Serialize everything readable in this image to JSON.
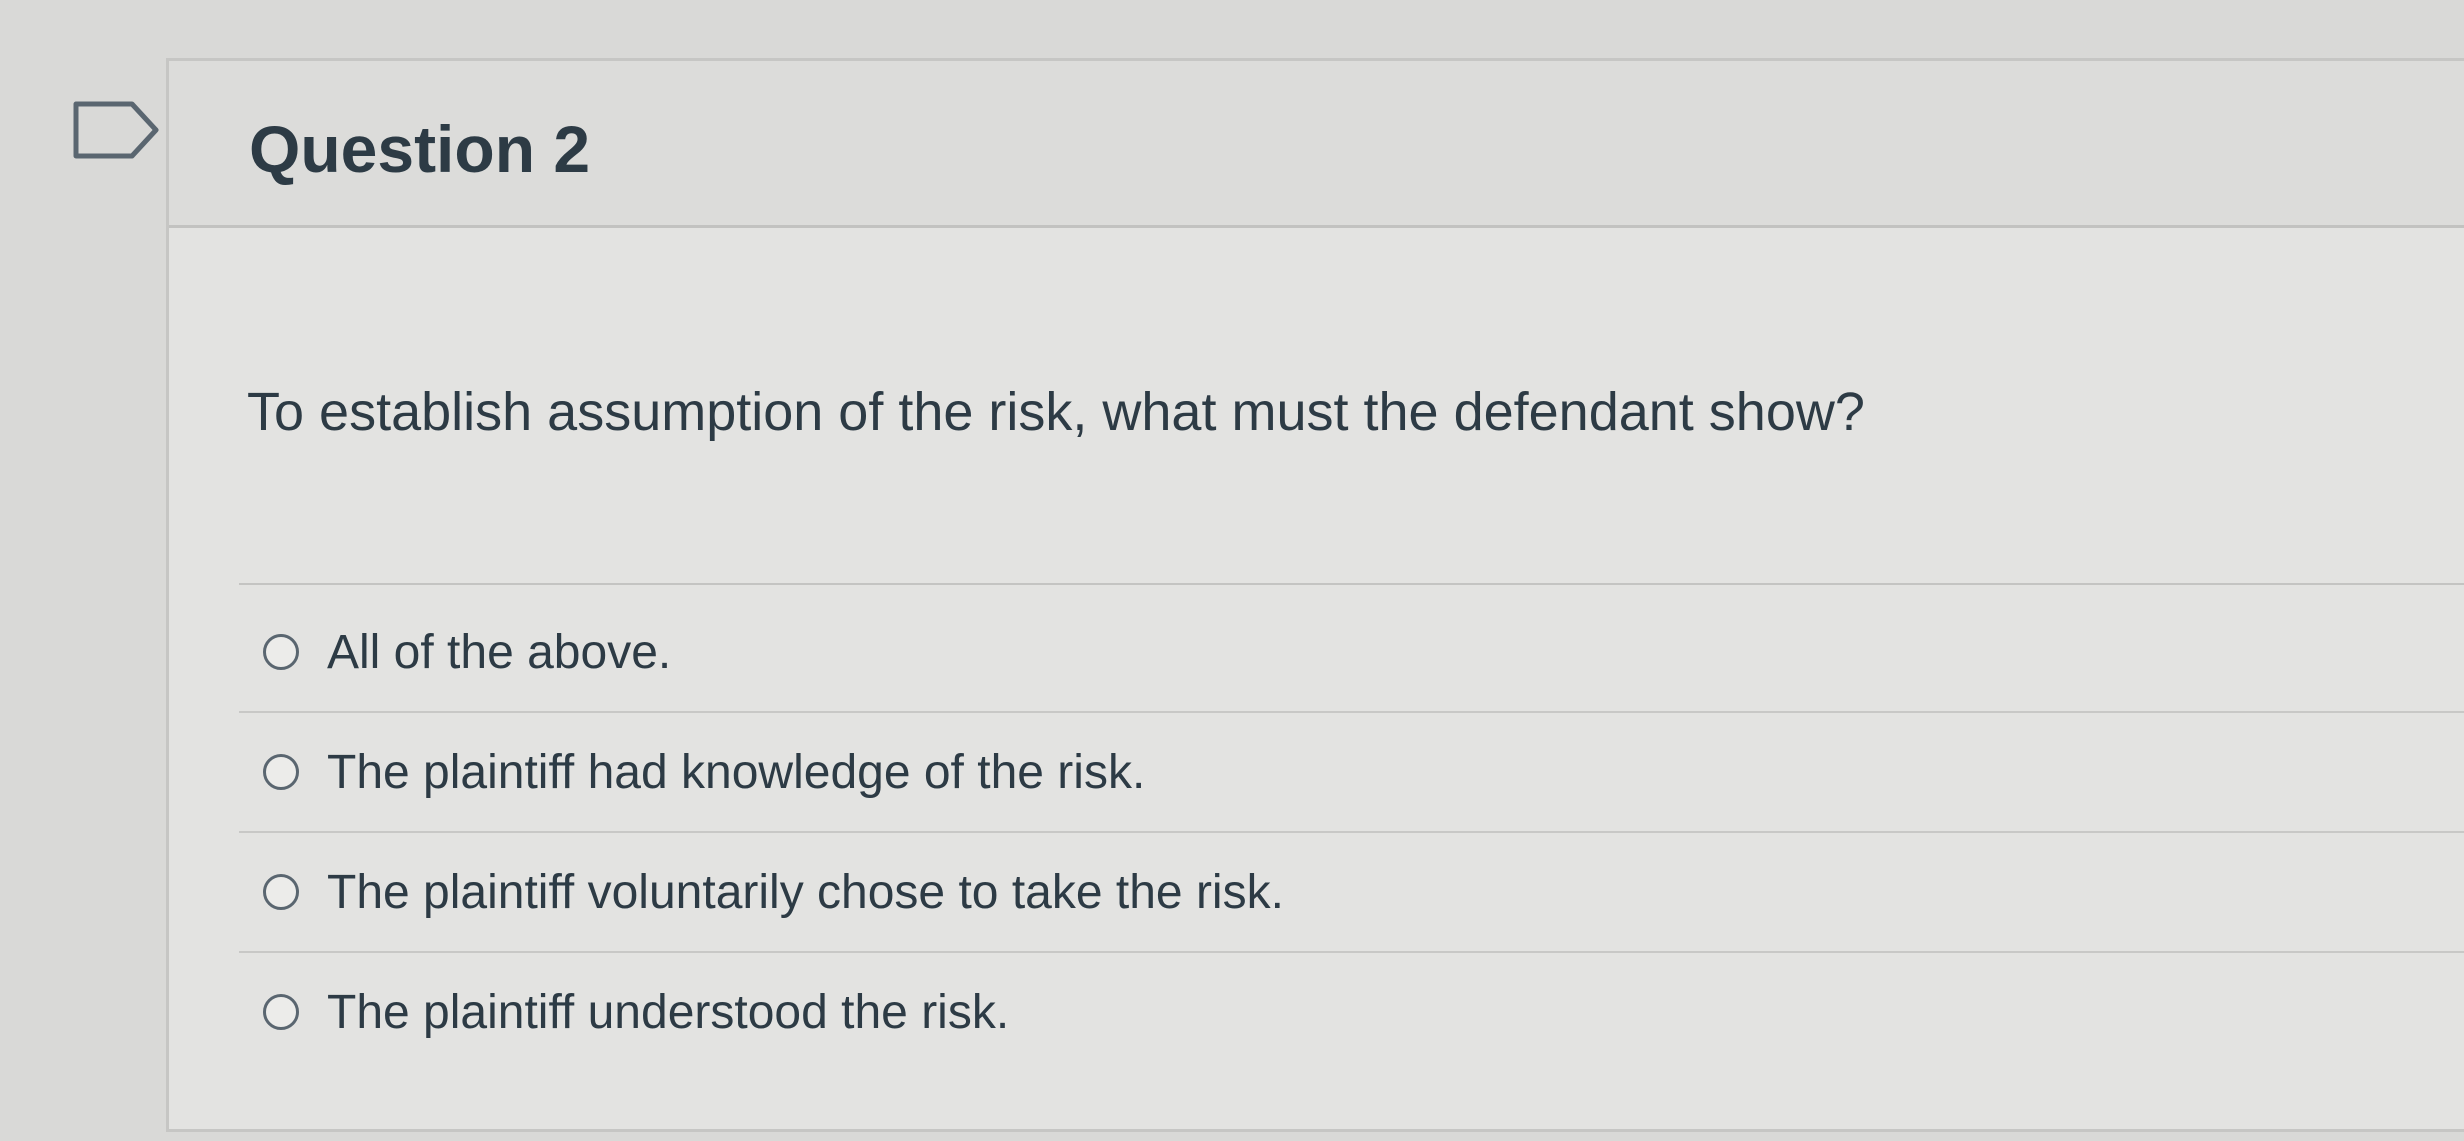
{
  "question": {
    "title": "Question 2",
    "text": "To establish assumption of the risk, what must the defendant show?"
  },
  "answers": [
    {
      "label": "All of the above."
    },
    {
      "label": "The plaintiff had knowledge of the risk."
    },
    {
      "label": "The plaintiff voluntarily chose to take the risk."
    },
    {
      "label": "The plaintiff understood the risk."
    }
  ],
  "icons": {
    "bookmark": "bookmark-flag-icon",
    "radio": "radio-unchecked-icon"
  },
  "colors": {
    "text": "#2d3b45",
    "background": "#d9d9d7",
    "card": "#e3e3e1"
  }
}
